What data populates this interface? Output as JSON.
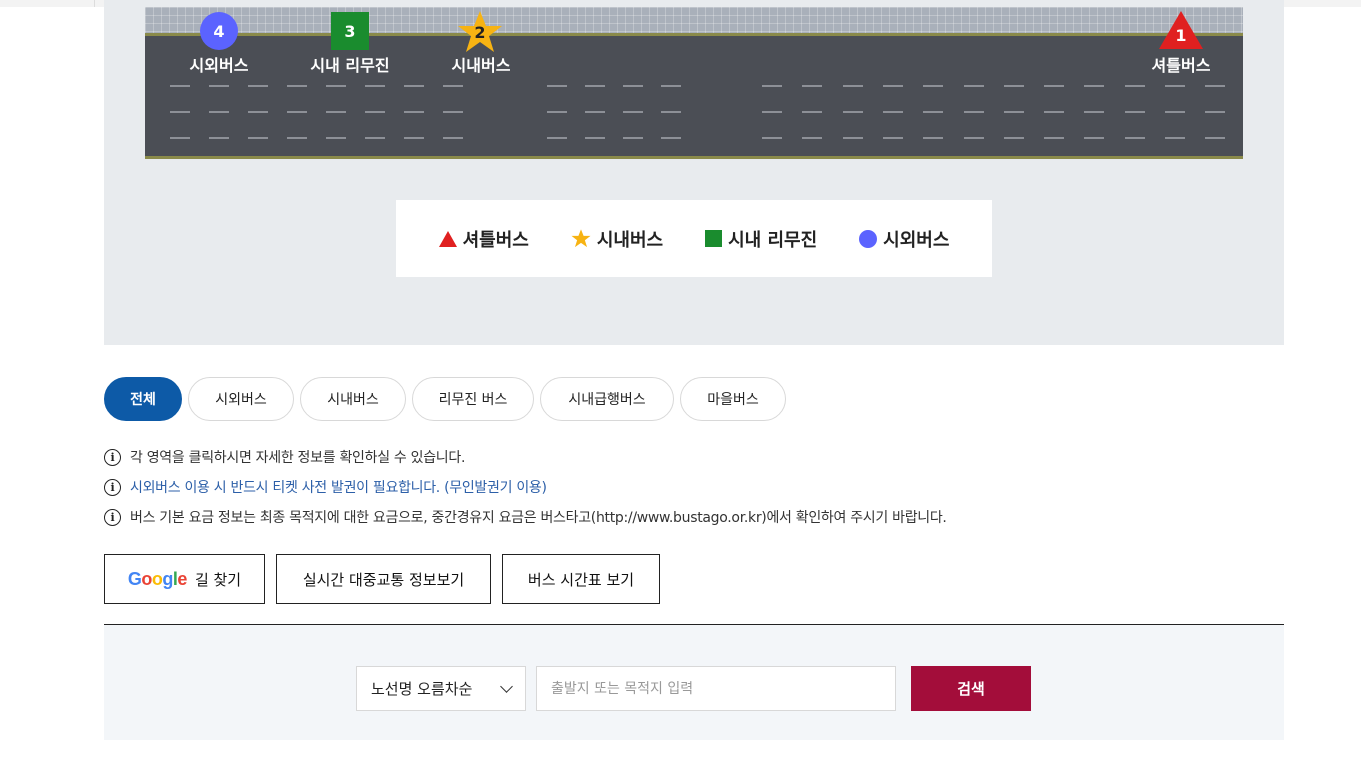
{
  "map": {
    "stops": [
      {
        "number": "4",
        "label": "시외버스",
        "icon": "circle-marker"
      },
      {
        "number": "3",
        "label": "시내 리무진",
        "icon": "square-marker"
      },
      {
        "number": "2",
        "label": "시내버스",
        "icon": "star-marker"
      },
      {
        "number": "1",
        "label": "셔틀버스",
        "icon": "triangle-marker"
      }
    ],
    "colors": {
      "circle": "#5b63ff",
      "square": "#1a8c2e",
      "star": "#f7b313",
      "triangle": "#e02020",
      "road": "#4b4e55"
    }
  },
  "legend": {
    "items": [
      {
        "label": "셔틀버스",
        "icon": "triangle"
      },
      {
        "label": "시내버스",
        "icon": "star"
      },
      {
        "label": "시내 리무진",
        "icon": "square"
      },
      {
        "label": "시외버스",
        "icon": "circle"
      }
    ]
  },
  "tabs": [
    "전체",
    "시외버스",
    "시내버스",
    "리무진 버스",
    "시내급행버스",
    "마을버스"
  ],
  "active_tab": "전체",
  "notes": [
    "각 영역을 클릭하시면 자세한 정보를 확인하실 수 있습니다.",
    "시외버스 이용 시 반드시 티켓 사전 발권이 필요합니다. (무인발권기 이용)",
    "버스 기본 요금 정보는 최종 목적지에 대한 요금으로, 중간경유지 요금은 버스타고(http://www.bustago.or.kr)에서 확인하여 주시기 바랍니다."
  ],
  "buttons": {
    "google_logo": "Google",
    "directions": "길 찾기",
    "realtime": "실시간 대중교통 정보보기",
    "timetable": "버스 시간표 보기"
  },
  "search": {
    "sort_selected": "노선명 오름차순",
    "placeholder": "출발지 또는 목적지 입력",
    "button": "검색"
  }
}
